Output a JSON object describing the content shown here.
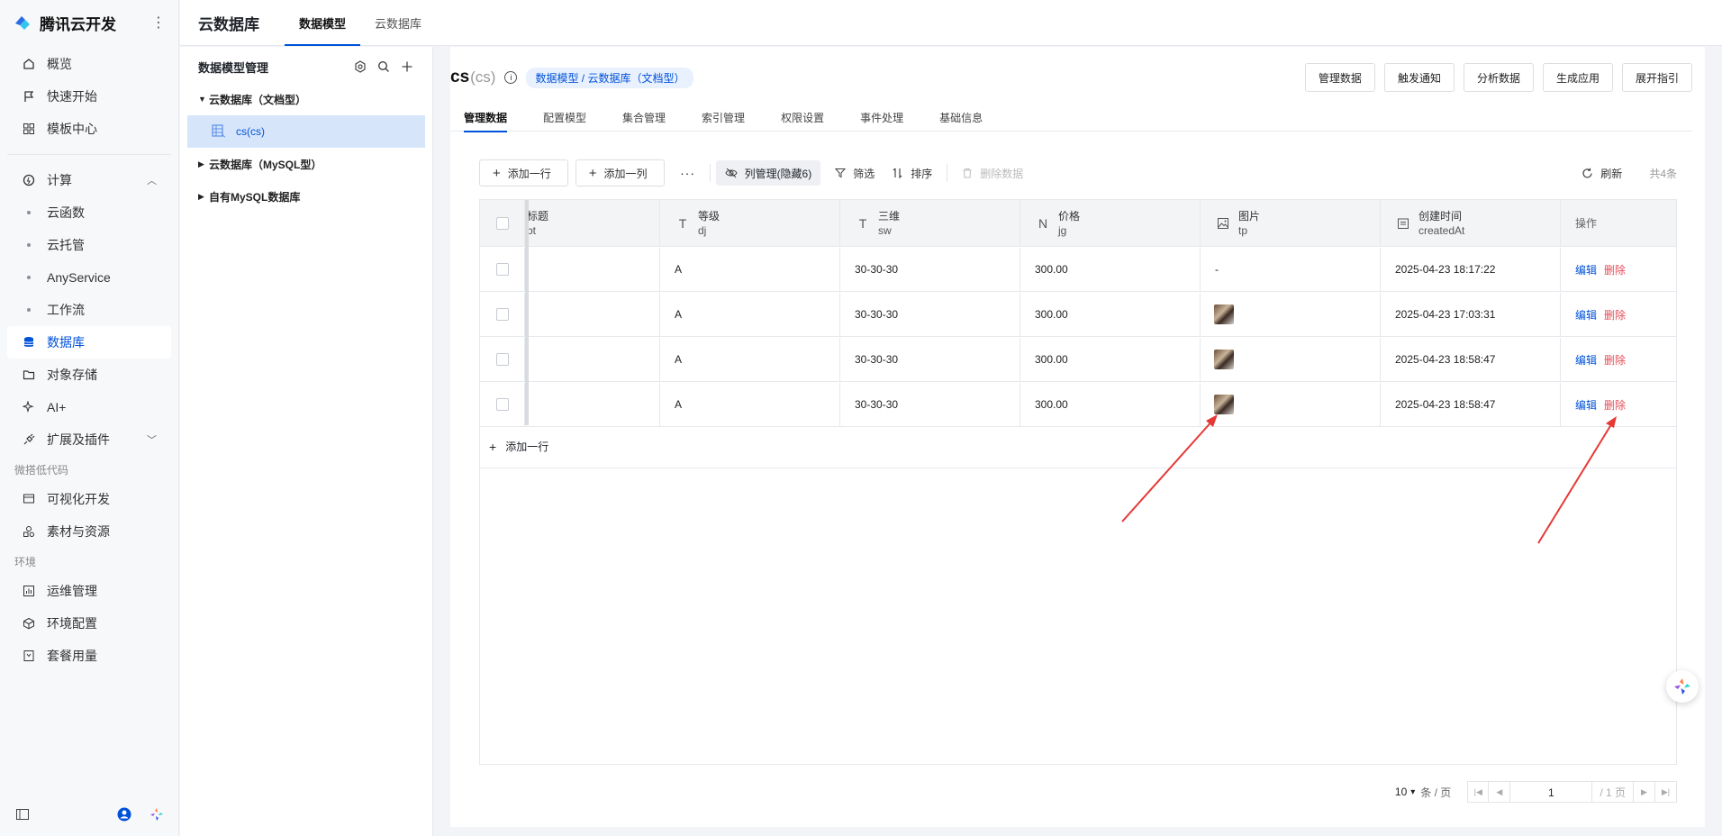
{
  "brand": {
    "name": "腾讯云开发",
    "more": "⋮"
  },
  "nav": {
    "items": [
      {
        "label": "概览",
        "icon": "home-icon"
      },
      {
        "label": "快速开始",
        "icon": "flag-icon"
      },
      {
        "label": "模板中心",
        "icon": "grid-icon"
      }
    ],
    "compute": {
      "label": "计算",
      "chev": "︿"
    },
    "compute_items": [
      "云函数",
      "云托管",
      "AnyService",
      "工作流"
    ],
    "db": "数据库",
    "storage": "对象存储",
    "ai": "AI+",
    "ext": {
      "label": "扩展及插件",
      "chev": "﹀"
    },
    "group_lowcode": "微搭低代码",
    "lowcode": [
      "可视化开发",
      "素材与资源"
    ],
    "group_env": "环境",
    "env": [
      "运维管理",
      "环境配置",
      "套餐用量"
    ]
  },
  "topbar": {
    "title": "云数据库",
    "tabs": [
      "数据模型",
      "云数据库"
    ]
  },
  "model_panel": {
    "title": "数据模型管理",
    "groups": [
      "云数据库（文档型）",
      "云数据库（MySQL型）",
      "自有MySQL数据库"
    ],
    "leaf": "cs(cs)"
  },
  "header": {
    "name": "cs",
    "sub": "(cs)",
    "info": "i",
    "crumb": "数据模型 / 云数据库（文档型）",
    "actions": [
      "管理数据",
      "触发通知",
      "分析数据",
      "生成应用",
      "展开指引"
    ]
  },
  "subtabs": [
    "管理数据",
    "配置模型",
    "集合管理",
    "索引管理",
    "权限设置",
    "事件处理",
    "基础信息"
  ],
  "toolbar": {
    "add_row": "添加一行",
    "add_col": "添加一列",
    "more": "···",
    "col_mgr": "列管理(隐藏6)",
    "filter": "筛选",
    "sort": "排序",
    "delete": "删除数据",
    "refresh": "刷新",
    "count": "共4条"
  },
  "table": {
    "columns": [
      {
        "title": "标题",
        "field": "bt",
        "icon": ""
      },
      {
        "title": "等级",
        "field": "dj",
        "icon": "T"
      },
      {
        "title": "三维",
        "field": "sw",
        "icon": "T"
      },
      {
        "title": "价格",
        "field": "jg",
        "icon": "N"
      },
      {
        "title": "图片",
        "field": "tp",
        "icon": "image-icon"
      },
      {
        "title": "创建时间",
        "field": "createdAt",
        "icon": "calendar-icon"
      }
    ],
    "ops_title": "操作",
    "rows": [
      {
        "dj": "A",
        "sw": "30-30-30",
        "jg": "300.00",
        "tp": "-",
        "createdAt": "2025-04-23 18:17:22"
      },
      {
        "dj": "A",
        "sw": "30-30-30",
        "jg": "300.00",
        "tp": "",
        "createdAt": "2025-04-23 17:03:31"
      },
      {
        "dj": "A",
        "sw": "30-30-30",
        "jg": "300.00",
        "tp": "",
        "createdAt": "2025-04-23 18:58:47"
      },
      {
        "dj": "A",
        "sw": "30-30-30",
        "jg": "300.00",
        "tp": "",
        "createdAt": "2025-04-23 18:58:47"
      }
    ],
    "edit": "编辑",
    "del": "删除",
    "add_row": "添加一行"
  },
  "pager": {
    "size": "10",
    "unit": "条 / 页",
    "page": "1",
    "total": "/ 1 页"
  },
  "colors": {
    "accent": "#0052d9",
    "danger": "#e34d59",
    "arrow": "#e53935"
  }
}
